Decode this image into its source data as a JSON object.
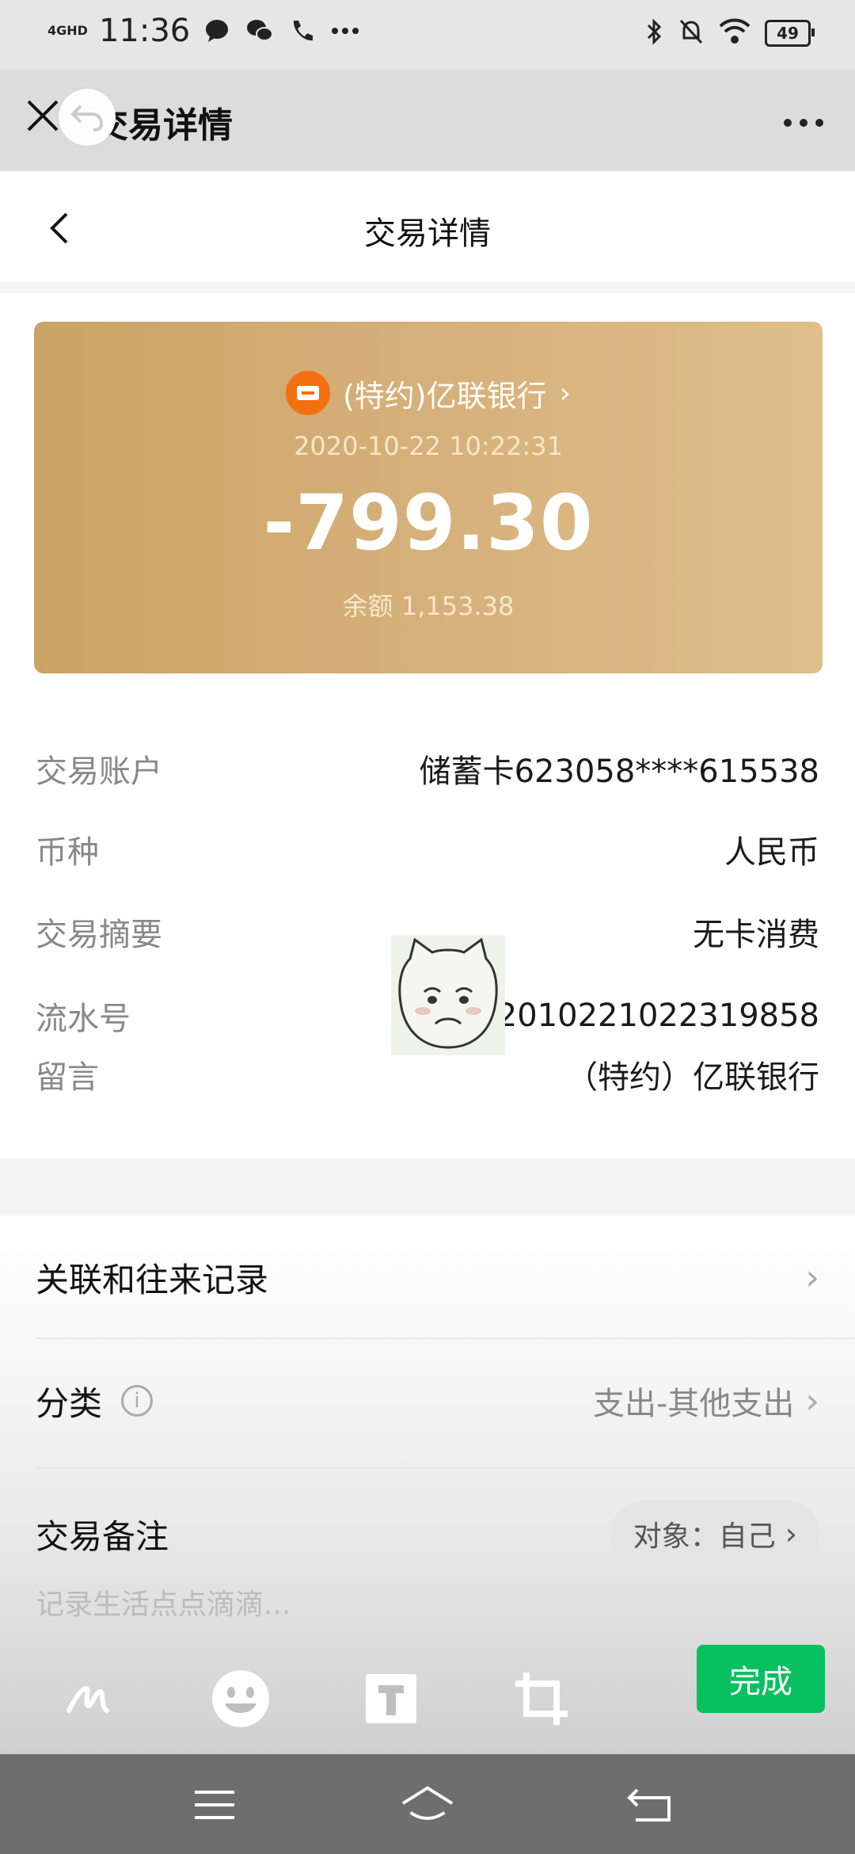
{
  "status_bar": {
    "network": "4GHD",
    "time": "11:36",
    "battery": "49",
    "icons": [
      "chat-bubble-icon",
      "wechat-icon",
      "phone-icon",
      "more-dots-icon",
      "bluetooth-icon",
      "mute-bell-icon",
      "wifi-icon",
      "battery-icon"
    ]
  },
  "outer_header": {
    "title": "交易详情",
    "close_icon": "close-icon",
    "undo_icon": "undo-icon",
    "more_icon": "more-icon"
  },
  "inner_header": {
    "title": "交易详情",
    "back_icon": "back-chevron-icon"
  },
  "card": {
    "merchant": "(特约)亿联银行",
    "date": "2020-10-22 10:22:31",
    "amount": "-799.30",
    "balance": "余额 1,153.38",
    "colors": {
      "start": "#cba366",
      "end": "#dfbf8a",
      "icon": "#f2700f"
    }
  },
  "details": [
    {
      "label": "交易账户",
      "value": "储蓄卡623058****615538"
    },
    {
      "label": "币种",
      "value": "人民币"
    },
    {
      "label": "交易摘要",
      "value": "无卡消费"
    },
    {
      "label": "流水号",
      "value": "1201022102231985​8"
    },
    {
      "label": "留言",
      "value": "（特约）亿联银行"
    }
  ],
  "links": {
    "related": "关联和往来记录",
    "category_label": "分类",
    "category_value": "支出-其他支出",
    "note_label": "交易备注",
    "object": "对象：自己",
    "note_placeholder": "记录生活点点滴滴..."
  },
  "toolbar": {
    "tools": [
      "pen-icon",
      "emoji-icon",
      "text-icon",
      "crop-icon"
    ],
    "done": "完成",
    "done_color": "#07c160"
  },
  "nav": {
    "icons": [
      "menu-icon",
      "home-icon",
      "back-icon"
    ]
  }
}
